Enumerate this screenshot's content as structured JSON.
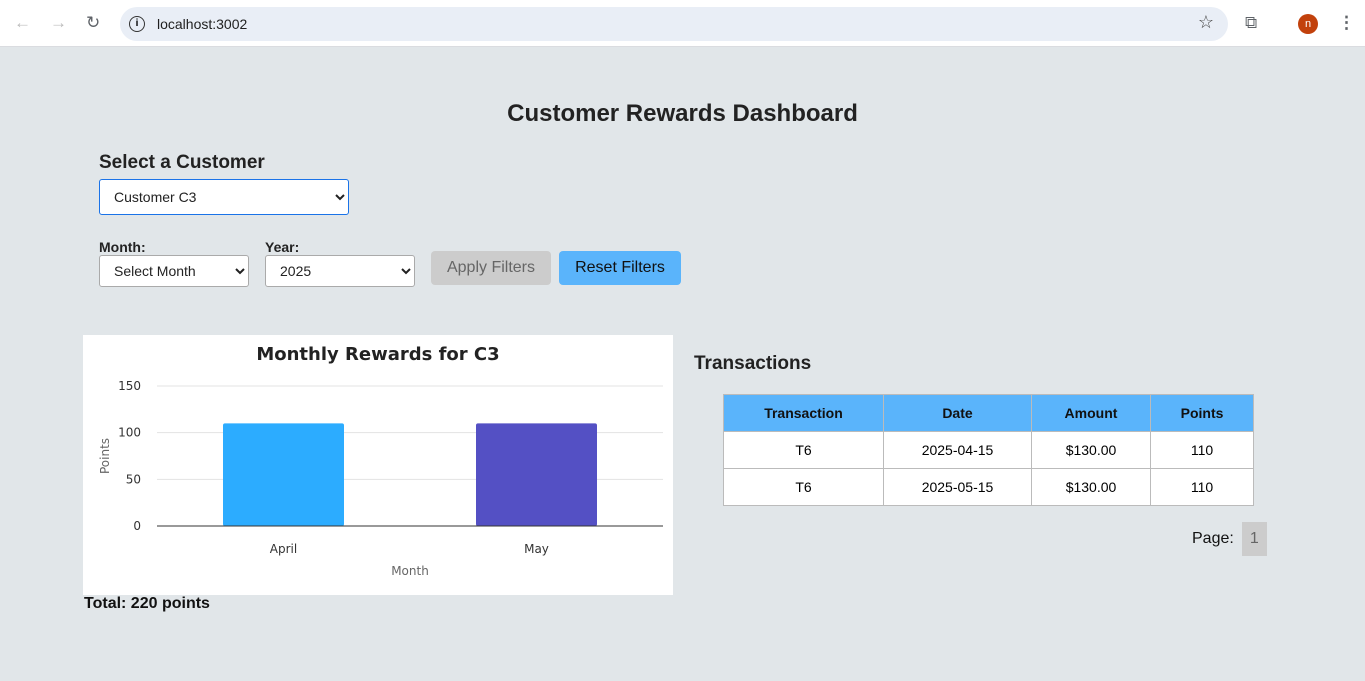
{
  "browser": {
    "url": "localhost:3002",
    "avatar": "n"
  },
  "title": "Customer Rewards Dashboard",
  "customer": {
    "label": "Select a Customer",
    "selected": "Customer C3"
  },
  "filters": {
    "month_label": "Month:",
    "month_value": "Select Month",
    "year_label": "Year:",
    "year_value": "2025",
    "apply": "Apply Filters",
    "reset": "Reset Filters"
  },
  "chart_data": {
    "type": "bar",
    "title": "Monthly Rewards for C3",
    "xlabel": "Month",
    "ylabel": "Points",
    "categories": [
      "April",
      "May"
    ],
    "values": [
      110,
      110
    ],
    "colors": [
      "#2cacff",
      "#5450c4"
    ],
    "ylim": [
      0,
      150
    ],
    "yticks": [
      0,
      50,
      100,
      150
    ],
    "grid": true
  },
  "total": "Total: 220 points",
  "transactions": {
    "title": "Transactions",
    "headers": [
      "Transaction",
      "Date",
      "Amount",
      "Points"
    ],
    "rows": [
      [
        "T6",
        "2025-04-15",
        "$130.00",
        "110"
      ],
      [
        "T6",
        "2025-05-15",
        "$130.00",
        "110"
      ]
    ]
  },
  "pager": {
    "label": "Page:",
    "current": "1"
  }
}
